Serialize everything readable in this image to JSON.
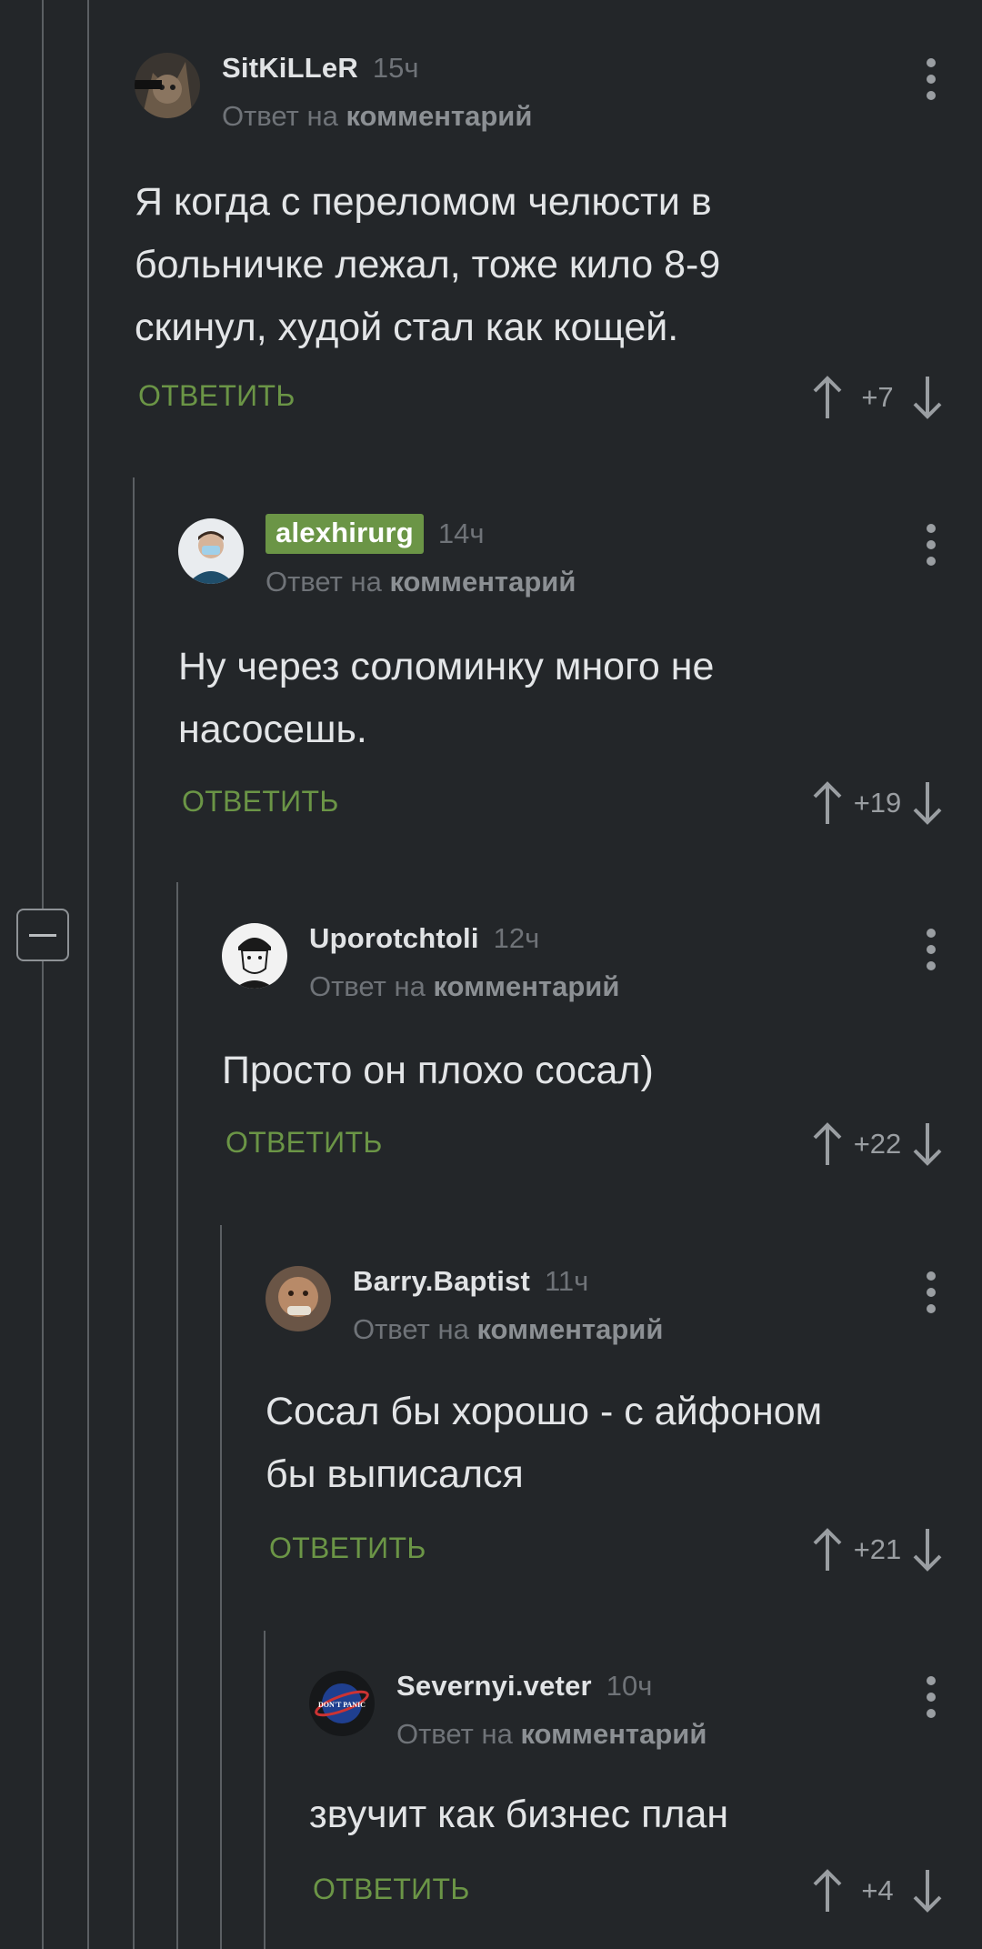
{
  "comments": [
    {
      "author": "SitKiLLeR",
      "time": "15ч",
      "reply_prefix": "Ответ на",
      "reply_link": "комментарий",
      "lines": [
        "Я когда с переломом челюсти в",
        "больничке лежал, тоже кило 8-9",
        "скинул, худой стал как кощей."
      ],
      "reply_label": "ОТВЕТИТЬ",
      "rating": "+7",
      "avatar_icon": "cat-avatar-icon"
    },
    {
      "author": "alexhirurg",
      "time": "14ч",
      "reply_prefix": "Ответ на",
      "reply_link": "комментарий",
      "lines": [
        "Ну через соломинку много не",
        "насосешь."
      ],
      "reply_label": "ОТВЕТИТЬ",
      "rating": "+19",
      "avatar_icon": "doctor-avatar-icon",
      "author_badge_color": "#6b9546"
    },
    {
      "author": "Uporotchtoli",
      "time": "12ч",
      "reply_prefix": "Ответ на",
      "reply_link": "комментарий",
      "lines": [
        "Просто он плохо сосал)"
      ],
      "reply_label": "ОТВЕТИТЬ",
      "rating": "+22",
      "avatar_icon": "drawing-avatar-icon"
    },
    {
      "author": "Barry.Baptist",
      "time": "11ч",
      "reply_prefix": "Ответ на",
      "reply_link": "комментарий",
      "lines": [
        "Сосал бы хорошо - с айфоном",
        "бы выписался"
      ],
      "reply_label": "ОТВЕТИТЬ",
      "rating": "+21",
      "avatar_icon": "face-avatar-icon"
    },
    {
      "author": "Severnyi.veter",
      "time": "10ч",
      "reply_prefix": "Ответ на",
      "reply_link": "комментарий",
      "lines": [
        "звучит как бизнес план"
      ],
      "reply_label": "ОТВЕТИТЬ",
      "rating": "+4",
      "avatar_icon": "dont-panic-avatar-icon",
      "avatar_text": "DON'T PANIC"
    }
  ],
  "colors": {
    "background": "#232629",
    "accent_green": "#6b9546",
    "thread_line": "#5b5f63",
    "muted_text": "#6f7378"
  }
}
